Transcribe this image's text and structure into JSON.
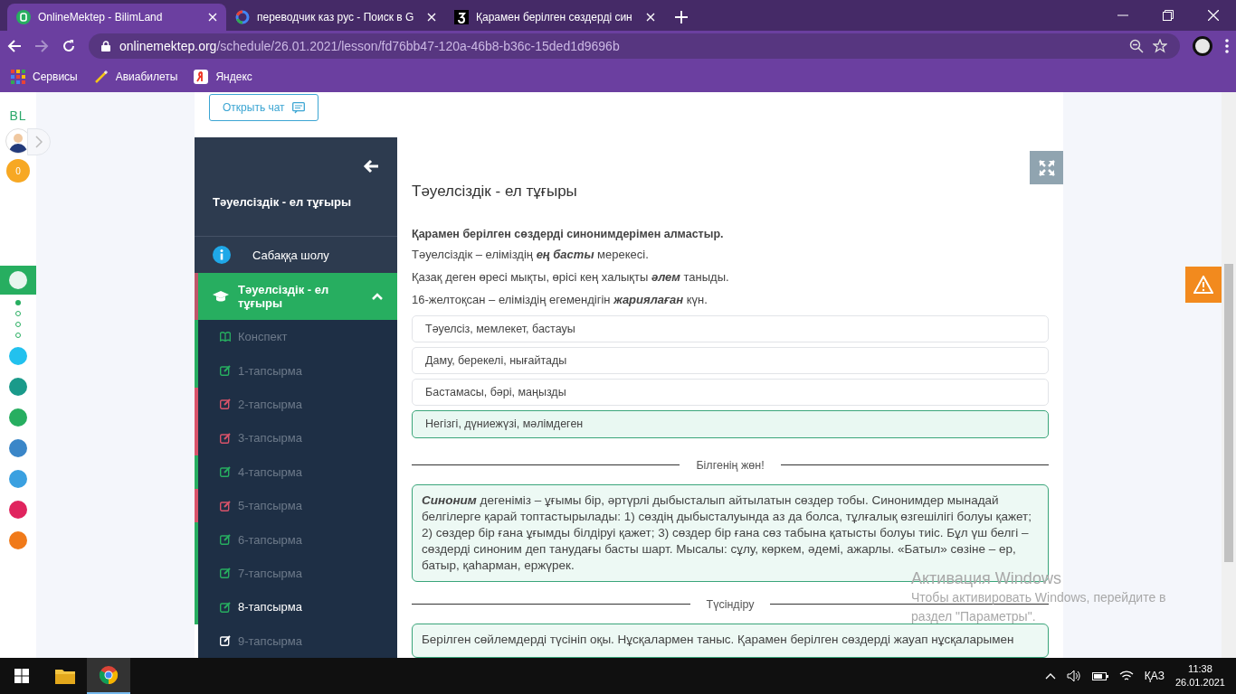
{
  "browser": {
    "tabs": [
      {
        "title": "OnlineMektep - BilimLand",
        "selected": true
      },
      {
        "title": "переводчик каз рус - Поиск в G",
        "selected": false
      },
      {
        "title": "Қарамен берілген сөздерді син",
        "selected": false
      }
    ],
    "url_host": "onlinemektep.org",
    "url_path": "/schedule/26.01.2021/lesson/fd76bb47-120a-46b8-b36c-15ded1d9696b",
    "bookmarks": [
      {
        "label": "Сервисы"
      },
      {
        "label": "Авиабилеты"
      },
      {
        "label": "Яндекс"
      }
    ]
  },
  "rail": {
    "logo": "BL",
    "score": "0"
  },
  "chat_button": "Открыть чат",
  "lesson_nav": {
    "title": "Тәуелсіздік - ел тұғыры",
    "overview": "Сабаққа шолу",
    "section": {
      "label": "Тәуелсіздік - ел тұғыры",
      "expanded": true
    },
    "items": [
      {
        "label": "Конспект",
        "kind": "konspekt",
        "color": "#27ae60",
        "selected": false
      },
      {
        "label": "1-тапсырма",
        "kind": "task",
        "color": "#27ae60",
        "selected": false
      },
      {
        "label": "2-тапсырма",
        "kind": "task",
        "color": "#d9536a",
        "selected": false
      },
      {
        "label": "3-тапсырма",
        "kind": "task",
        "color": "#d9536a",
        "selected": false
      },
      {
        "label": "4-тапсырма",
        "kind": "task",
        "color": "#27ae60",
        "selected": false
      },
      {
        "label": "5-тапсырма",
        "kind": "task",
        "color": "#d9536a",
        "selected": false
      },
      {
        "label": "6-тапсырма",
        "kind": "task",
        "color": "#27ae60",
        "selected": false
      },
      {
        "label": "7-тапсырма",
        "kind": "task",
        "color": "#27ae60",
        "selected": false
      },
      {
        "label": "8-тапсырма",
        "kind": "task",
        "color": "#27ae60",
        "selected": true
      },
      {
        "label": "9-тапсырма",
        "kind": "task",
        "color": "#ffffff",
        "selected": false
      }
    ]
  },
  "task": {
    "title": "Тәуелсіздік - ел тұғыры",
    "question": "Қарамен берілген сөздерді синонимдерімен алмастыр.",
    "sentences": [
      "Тәуелсіздік – еліміздің **ең басты** мерекесі.",
      "Қазақ деген өресі мықты, өрісі кең халықты **әлем** таныды.",
      "16-желтоқсан – еліміздің егемендігін **жариялаған** күн."
    ],
    "options": [
      {
        "text": "Тәуелсіз, мемлекет, бастауы",
        "selected": false
      },
      {
        "text": "Даму, берекелі, нығайтады",
        "selected": false
      },
      {
        "text": "Бастамасы, бәрі, маңызды",
        "selected": false
      },
      {
        "text": "Негізгі, дүниежүзі, мәлімдеген",
        "selected": true
      }
    ],
    "sections": [
      {
        "heading": "Білгенің жөн!",
        "text": "**Синоним** дегеніміз – ұғымы бір, әртүрлі дыбысталып айтылатын сөздер тобы. Синонимдер мынадай белгілерге қарай топтастырылады: 1) сөздің дыбысталуында аз да болса, тұлғалық өзгешілігі болуы қажет; 2) сөздер бір ғана ұғымды білдіруі қажет; 3) сөздер бір ғана сөз табына қатысты болуы тиіс. Бұл үш белгі – сөздерді синоним деп танудағы басты шарт. Мысалы: сұлу, көркем, әдемі, ажарлы. «Батыл» сөзіне – ер, батыр, қаһарман, ержүрек."
      },
      {
        "heading": "Түсіндіру",
        "text": "Берілген сөйлемдерді түсініп оқы. Нұсқалармен таныс. Қарамен берілген сөздерді жауап нұсқаларымен"
      }
    ]
  },
  "activation": {
    "title": "Активация Windows",
    "text": "Чтобы активировать Windows, перейдите в раздел \"Параметры\"."
  },
  "taskbar": {
    "language": "ҚАЗ",
    "time": "11:38",
    "date": "26.01.2021"
  }
}
